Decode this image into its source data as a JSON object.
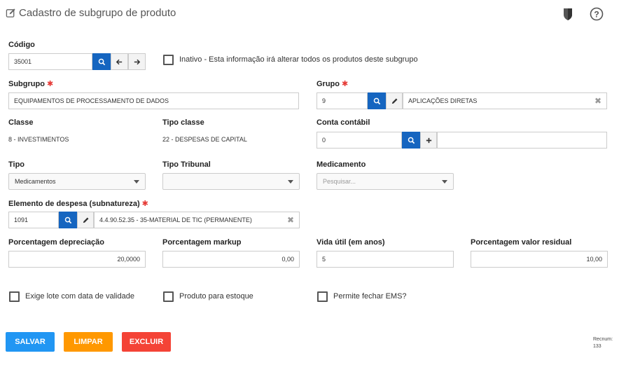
{
  "header": {
    "title": "Cadastro de subgrupo de produto"
  },
  "codigo": {
    "label": "Código",
    "value": "35001"
  },
  "inativo": {
    "label": "Inativo - Esta informação irá alterar todos os produtos deste subgrupo",
    "checked": false
  },
  "subgrupo": {
    "label": "Subgrupo",
    "value": "EQUIPAMENTOS DE PROCESSAMENTO DE DADOS"
  },
  "grupo": {
    "label": "Grupo",
    "code": "9",
    "description": "APLICAÇÕES DIRETAS"
  },
  "classe": {
    "label": "Classe",
    "value": "8 - INVESTIMENTOS"
  },
  "tipo_classe": {
    "label": "Tipo classe",
    "value": "22 - DESPESAS DE CAPITAL"
  },
  "conta_contabil": {
    "label": "Conta contábil",
    "value": "0",
    "description": ""
  },
  "tipo": {
    "label": "Tipo",
    "selected": "Medicamentos"
  },
  "tipo_tribunal": {
    "label": "Tipo Tribunal",
    "selected": ""
  },
  "medicamento": {
    "label": "Medicamento",
    "placeholder": "Pesquisar..."
  },
  "elemento_despesa": {
    "label": "Elemento de despesa (subnatureza)",
    "code": "1091",
    "description": "4.4.90.52.35 - 35-MATERIAL DE TIC (PERMANENTE)"
  },
  "porcentagem_depreciacao": {
    "label": "Porcentagem depreciação",
    "value": "20,0000"
  },
  "porcentagem_markup": {
    "label": "Porcentagem markup",
    "value": "0,00"
  },
  "vida_util": {
    "label": "Vida útil (em anos)",
    "value": "5"
  },
  "porcentagem_residual": {
    "label": "Porcentagem valor residual",
    "value": "10,00"
  },
  "checkboxes": {
    "exige_lote": {
      "label": "Exige lote com data de validade",
      "checked": false
    },
    "produto_estoque": {
      "label": "Produto para estoque",
      "checked": false
    },
    "permite_ems": {
      "label": "Permite fechar EMS?",
      "checked": false
    }
  },
  "actions": {
    "salvar": "SALVAR",
    "limpar": "LIMPAR",
    "excluir": "EXCLUIR"
  },
  "recnum": {
    "label": "Recnum:",
    "value": "133"
  },
  "colors": {
    "primary": "#1565c0",
    "salvar": "#2196f3",
    "limpar": "#ff9800",
    "excluir": "#f44336",
    "required": "#e53935"
  }
}
